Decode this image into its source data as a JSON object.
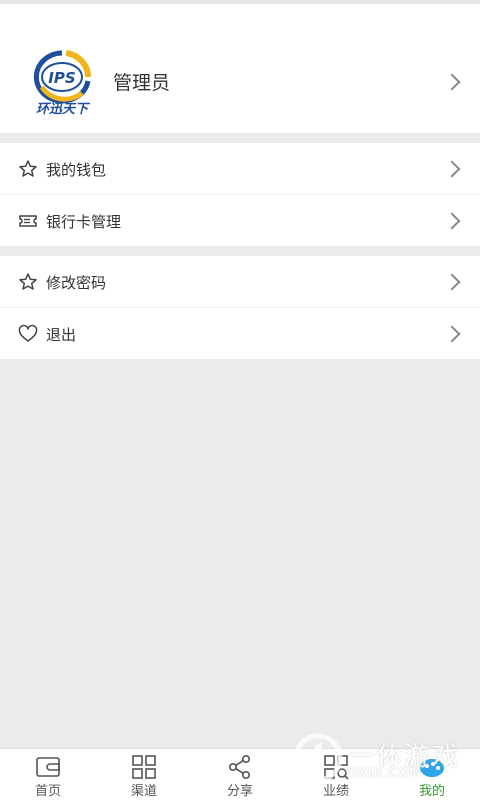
{
  "profile": {
    "name": "管理员",
    "logo_text": "IPS",
    "logo_caption": "环迅天下"
  },
  "menu_group_1": [
    {
      "label": "我的钱包",
      "icon": "star-icon"
    },
    {
      "label": "银行卡管理",
      "icon": "ticket-icon"
    }
  ],
  "menu_group_2": [
    {
      "label": "修改密码",
      "icon": "star-icon"
    },
    {
      "label": "退出",
      "icon": "heart-icon"
    }
  ],
  "tabs": [
    {
      "label": "首页",
      "icon": "wallet-icon"
    },
    {
      "label": "渠道",
      "icon": "grid-icon"
    },
    {
      "label": "分享",
      "icon": "share-icon"
    },
    {
      "label": "业绩",
      "icon": "grid-search-icon"
    },
    {
      "label": "我的",
      "icon": "user-cloud-icon",
      "active": true
    }
  ],
  "watermark": {
    "title": "一休游戏",
    "sub": "YIXUI.COM"
  },
  "colors": {
    "active_tab": "#3a9a3a",
    "background": "#ebebeb",
    "logo_blue": "#1e4f9c",
    "logo_yellow": "#f0b51d"
  }
}
